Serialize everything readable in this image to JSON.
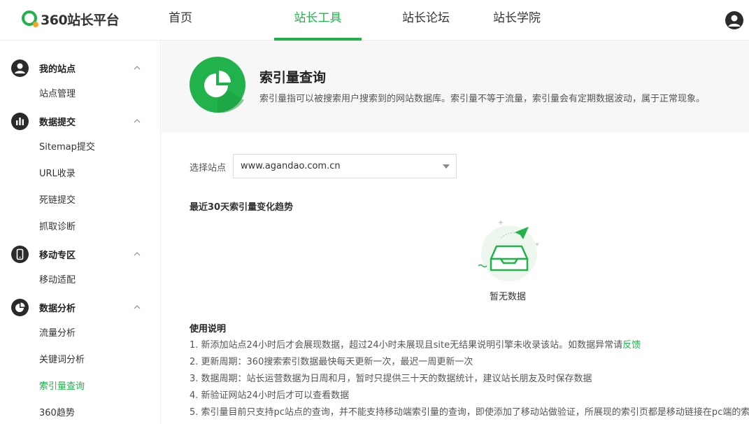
{
  "header": {
    "logo_text": "360站长平台",
    "nav": [
      {
        "label": "首页"
      },
      {
        "label": "站长工具"
      },
      {
        "label": "站长论坛"
      },
      {
        "label": "站长学院"
      }
    ],
    "active_nav": "站长工具"
  },
  "sidebar": {
    "groups": [
      {
        "label": "我的站点",
        "icon": "user-icon",
        "items": [
          "站点管理"
        ]
      },
      {
        "label": "数据提交",
        "icon": "bar-chart-icon",
        "items": [
          "Sitemap提交",
          "URL收录",
          "死链提交",
          "抓取诊断"
        ]
      },
      {
        "label": "移动专区",
        "icon": "mobile-icon",
        "items": [
          "移动适配"
        ]
      },
      {
        "label": "数据分析",
        "icon": "pie-chart-icon",
        "items": [
          "流量分析",
          "关键词分析",
          "索引量查询",
          "360趋势"
        ]
      }
    ],
    "active_item": "索引量查询"
  },
  "banner": {
    "title": "索引量查询",
    "description": "索引量指可以被搜索用户搜索到的网站数据库。索引量不等于流量，索引量会有定期数据波动，属于正常现象。"
  },
  "site_selector": {
    "label": "选择站点",
    "value": "www.agandao.com.cn"
  },
  "trend": {
    "title": "最近30天索引量变化趋势",
    "empty_text": "暂无数据"
  },
  "usage": {
    "title": "使用说明",
    "lines": [
      "1. 新添加站点24小时后才会展现数据，超过24小时未展现且site无结果说明引擎未收录该站。如数据异常请",
      "2. 更新周期：360搜索索引数据最快每天更新一次，最迟一周更新一次",
      "3. 数据周期：站长运营数据为日周和月，暂时只提供三十天的数据统计，建议站长朋友及时保存数据",
      "4. 新验证网站24小时后才可以查看数据",
      "5. 索引量目前只支持pc站点的查询，并不能支持移动端索引量的查询，即使添加了移动站做验证，所展现的索引页都是移动链接在pc端的索引"
    ],
    "feedback_link": "反馈"
  },
  "colors": {
    "accent": "#21b24b",
    "dark_icon": "#2a2a2a"
  }
}
